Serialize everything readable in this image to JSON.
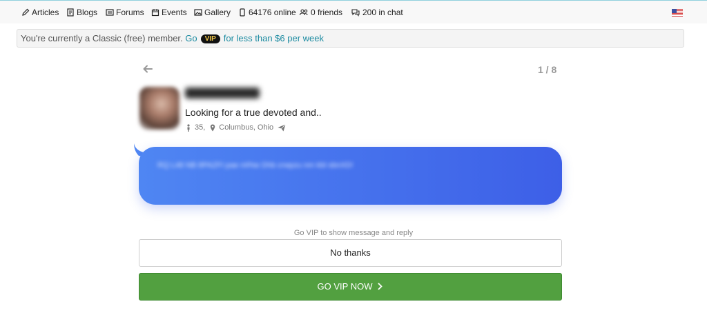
{
  "nav": {
    "items": [
      {
        "label": "Articles",
        "icon": "pencil-icon"
      },
      {
        "label": "Blogs",
        "icon": "blog-icon"
      },
      {
        "label": "Forums",
        "icon": "forums-icon"
      },
      {
        "label": "Events",
        "icon": "calendar-icon"
      },
      {
        "label": "Gallery",
        "icon": "gallery-icon"
      },
      {
        "label": "64176 online",
        "icon": "phone-icon"
      },
      {
        "label": "0 friends",
        "icon": "friends-icon"
      },
      {
        "label": "200 in chat",
        "icon": "chat-icon"
      }
    ],
    "flag_icon": "us-flag-icon"
  },
  "banner": {
    "text": "You're currently a Classic (free) member.",
    "go_link": "Go",
    "vip_badge": "VIP",
    "offer_link": "for less than $6 per week"
  },
  "pager": "1 / 8",
  "profile": {
    "headline": "Looking for a true devoted and..",
    "age": "35,",
    "location": "Columbus, Ohio"
  },
  "message": {
    "hint": "Go VIP to show message and reply",
    "no_thanks_label": "No thanks",
    "go_vip_label": "GO VIP NOW"
  },
  "colors": {
    "bubble_start": "#4f86f3",
    "bubble_end": "#3d5fe7",
    "vip_button": "#52a040",
    "link": "#1a8aa0"
  }
}
